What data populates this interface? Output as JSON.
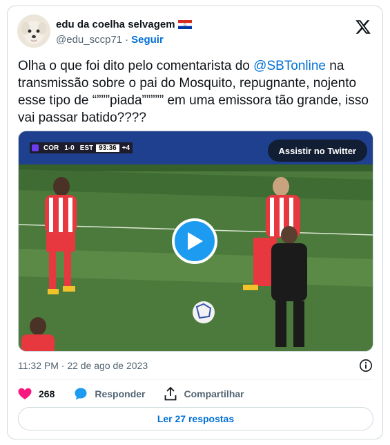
{
  "author": {
    "name": "edu da coelha selvagem",
    "handle": "@edu_sccp71",
    "separator": "·",
    "follow_label": "Seguir"
  },
  "tweet": {
    "text_before": "Olha o que foi dito pelo comentarista do ",
    "mention": "@SBTonline",
    "text_after": " na transmissão sobre o pai do Mosquito, repugnante, nojento esse tipo de “”””piada””””” em uma emissora tão grande, isso vai passar batido????"
  },
  "media": {
    "watch_label": "Assistir no Twitter",
    "scoreboard": {
      "home": "COR",
      "score": "1-0",
      "away": "EST",
      "clock": "93:36",
      "added": "+4"
    }
  },
  "timestamp": "11:32 PM · 22 de ago de 2023",
  "actions": {
    "likes": "268",
    "reply_label": "Responder",
    "share_label": "Compartilhar"
  },
  "read_replies": "Ler 27 respostas",
  "colors": {
    "link": "#006fd6",
    "like": "#f91880",
    "reply": "#1d9bf0",
    "play": "#1d9bf0",
    "muted": "#536471"
  }
}
